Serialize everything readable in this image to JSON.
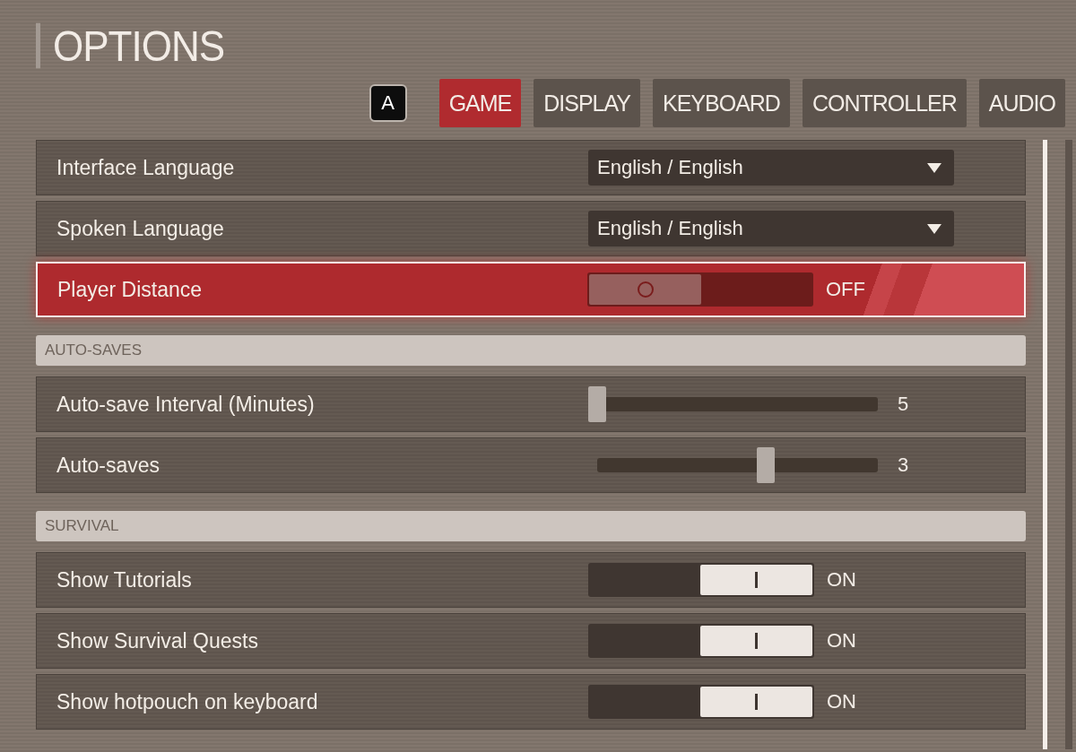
{
  "title": "OPTIONS",
  "hint_key": "A",
  "tabs": [
    {
      "label": "GAME",
      "selected": true
    },
    {
      "label": "DISPLAY",
      "selected": false
    },
    {
      "label": "KEYBOARD",
      "selected": false
    },
    {
      "label": "CONTROLLER",
      "selected": false
    },
    {
      "label": "AUDIO",
      "selected": false
    }
  ],
  "rows": [
    {
      "kind": "dropdown",
      "label": "Interface Language",
      "value": "English / English",
      "selected": false
    },
    {
      "kind": "dropdown",
      "label": "Spoken Language",
      "value": "English / English",
      "selected": false
    },
    {
      "kind": "toggle",
      "label": "Player Distance",
      "on": false,
      "reading": "OFF",
      "selected": true
    },
    {
      "kind": "header",
      "label": "AUTO-SAVES"
    },
    {
      "kind": "slider",
      "label": "Auto-save Interval (Minutes)",
      "level": 0,
      "reading": "5",
      "selected": false
    },
    {
      "kind": "slider",
      "label": "Auto-saves",
      "level": 0.6,
      "reading": "3",
      "selected": false
    },
    {
      "kind": "header",
      "label": "SURVIVAL"
    },
    {
      "kind": "toggle",
      "label": "Show Tutorials",
      "on": true,
      "reading": "ON",
      "selected": false
    },
    {
      "kind": "toggle",
      "label": "Show Survival Quests",
      "on": true,
      "reading": "ON",
      "selected": false
    },
    {
      "kind": "toggle",
      "label": "Show hotpouch on keyboard",
      "on": true,
      "reading": "ON",
      "selected": false
    }
  ]
}
